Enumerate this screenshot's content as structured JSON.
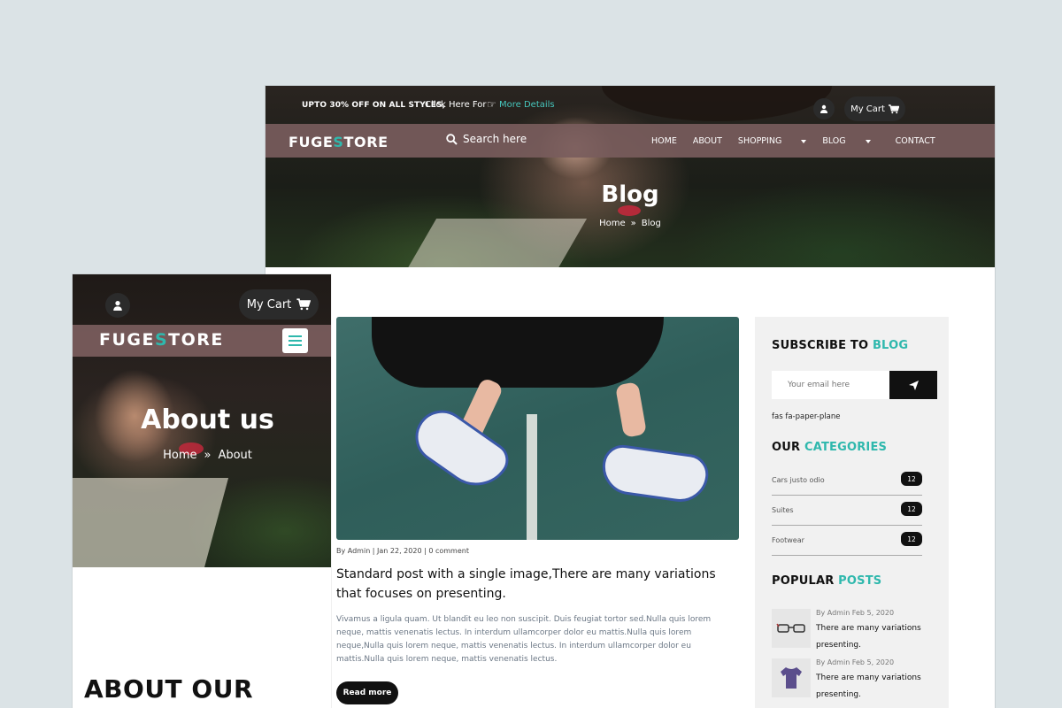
{
  "desktop": {
    "topbar": {
      "promo": "UPTO 30% OFF ON ALL STYLES,",
      "click_text": "Click Here For",
      "more_link": "More Details",
      "cart_label": "My Cart"
    },
    "navbar": {
      "logo_a": "FUGE",
      "logo_s": "S",
      "logo_b": "TORE",
      "search_placeholder": "Search here",
      "menu": [
        "HOME",
        "ABOUT",
        "SHOPPING",
        "BLOG",
        "CONTACT"
      ]
    },
    "hero": {
      "title": "Blog",
      "crumb_home": "Home",
      "crumb_current": "Blog"
    },
    "post": {
      "meta": "By Admin | Jan 22, 2020 | 0 comment",
      "title": "Standard post with a single image,There are many variations that focuses on presenting.",
      "excerpt": "Vivamus a ligula quam. Ut blandit eu leo non suscipit. Duis feugiat tortor sed.Nulla quis lorem neque, mattis venenatis lectus. In interdum ullamcorper dolor eu mattis.Nulla quis lorem neque,Nulla quis lorem neque, mattis venenatis lectus. In interdum ullamcorper dolor eu mattis.Nulla quis lorem neque, mattis venenatis lectus.",
      "read_more": "Read more"
    },
    "sidebar": {
      "subscribe_a": "SUBSCRIBE TO ",
      "subscribe_b": "BLOG",
      "email_placeholder": "Your email here",
      "icon_note": "fas fa-paper-plane",
      "categories_a": "OUR ",
      "categories_b": "CATEGORIES",
      "categories": [
        {
          "name": "Cars justo odio",
          "count": "12"
        },
        {
          "name": "Suites",
          "count": "12"
        },
        {
          "name": "Footwear",
          "count": "12"
        }
      ],
      "popular_a": "POPULAR ",
      "popular_b": "POSTS",
      "popular": [
        {
          "date": "By Admin Feb 5, 2020",
          "title": "There are many variations presenting."
        },
        {
          "date": "By Admin Feb 5, 2020",
          "title": "There are many variations presenting."
        }
      ]
    }
  },
  "mobile": {
    "cart_label": "My Cart",
    "logo_a": "FUGE",
    "logo_s": "S",
    "logo_b": "TORE",
    "title": "About us",
    "crumb_home": "Home",
    "crumb_current": "About",
    "section_heading": "ABOUT OUR"
  },
  "colors": {
    "accent": "#2fb8ad",
    "nav_bar": "#785c5c",
    "background": "#dbe3e6"
  }
}
